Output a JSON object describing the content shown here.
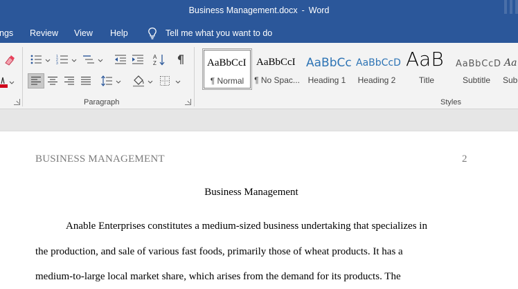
{
  "window": {
    "document_name": "Business Management.docx",
    "separator": "-",
    "app_name": "Word"
  },
  "menu": {
    "items": [
      "ngs",
      "Review",
      "View",
      "Help"
    ],
    "tell_me": "Tell me what you want to do"
  },
  "ribbon": {
    "paragraph_label": "Paragraph",
    "styles_label": "Styles",
    "styles": [
      {
        "sample": "AaBbCcI",
        "name": "¶ Normal"
      },
      {
        "sample": "AaBbCcI",
        "name": "¶ No Spac..."
      },
      {
        "sample": "AaBbCc",
        "name": "Heading 1"
      },
      {
        "sample": "AaBbCcD",
        "name": "Heading 2"
      },
      {
        "sample": "AaB",
        "name": "Title"
      },
      {
        "sample": "AaBbCcD",
        "name": "Subtitle"
      },
      {
        "sample": "Aa",
        "name": "Sub"
      }
    ],
    "colors": {
      "highlight_pen": "#e8405a",
      "font_color": "#d0021b",
      "heading_blue": "#2e74b5"
    }
  },
  "document": {
    "header_left": "BUSINESS MANAGEMENT",
    "header_right": "2",
    "title": "Business Management",
    "lines": [
      "Anable Enterprises constitutes a medium-sized business undertaking that specializes in",
      "the production, and sale of various fast foods, primarily those of wheat products. It has a",
      "medium-to-large local market share, which arises from the demand for its products. The"
    ]
  }
}
